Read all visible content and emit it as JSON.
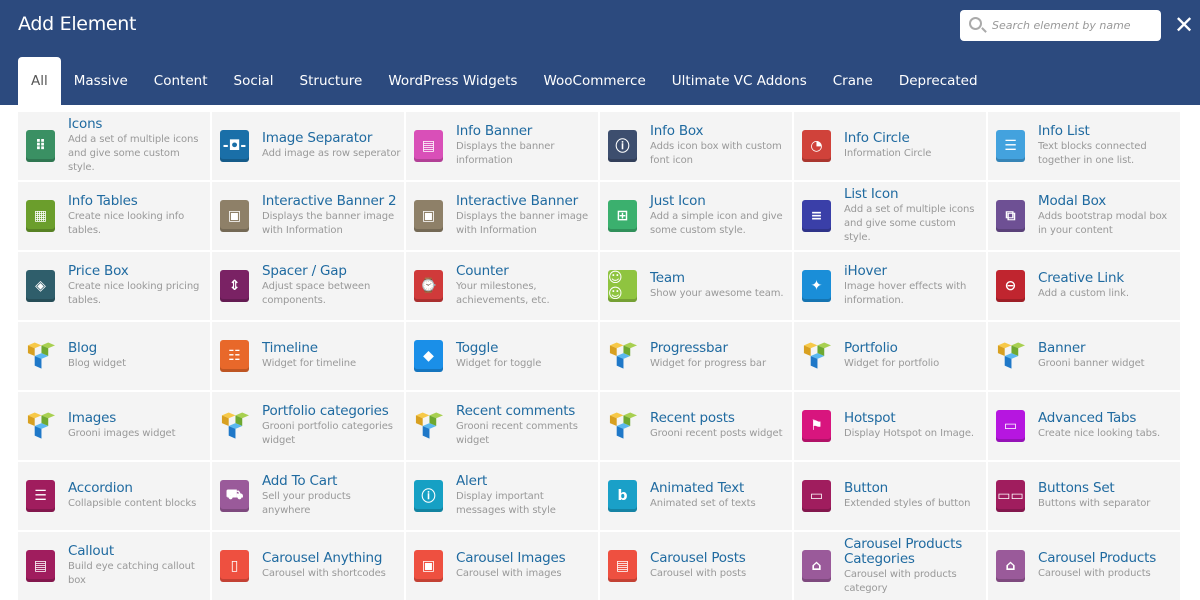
{
  "header": {
    "title": "Add Element",
    "search_placeholder": "Search element by name",
    "close_icon": "✕"
  },
  "tabs": [
    "All",
    "Massive",
    "Content",
    "Social",
    "Structure",
    "WordPress Widgets",
    "WooCommerce",
    "Ultimate VC Addons",
    "Crane",
    "Deprecated"
  ],
  "active_tab": "All",
  "elements": [
    {
      "name": "Icons",
      "desc": "Add a set of multiple icons and give some custom style.",
      "icon": "grid-icon",
      "color": "#3a9063",
      "glyph": "⠿"
    },
    {
      "name": "Image Separator",
      "desc": "Add image as row seperator",
      "icon": "separator-icon",
      "color": "#1a6fa8",
      "glyph": "-◘-"
    },
    {
      "name": "Info Banner",
      "desc": "Displays the banner information",
      "icon": "banner-icon",
      "color": "#d94fb8",
      "glyph": "▤"
    },
    {
      "name": "Info Box",
      "desc": "Adds icon box with custom font icon",
      "icon": "info-box-icon",
      "color": "#3d4e6e",
      "glyph": "ⓘ"
    },
    {
      "name": "Info Circle",
      "desc": "Information Circle",
      "icon": "info-circle-icon",
      "color": "#d0423a",
      "glyph": "◔"
    },
    {
      "name": "Info List",
      "desc": "Text blocks connected together in one list.",
      "icon": "list-icon",
      "color": "#43a2de",
      "glyph": "☰"
    },
    {
      "name": "Info Tables",
      "desc": "Create nice looking info tables.",
      "icon": "table-icon",
      "color": "#6b9e2c",
      "glyph": "▦"
    },
    {
      "name": "Interactive Banner 2",
      "desc": "Displays the banner image with Information",
      "icon": "image-icon",
      "color": "#8e8068",
      "glyph": "▣"
    },
    {
      "name": "Interactive Banner",
      "desc": "Displays the banner image with Information",
      "icon": "image-icon",
      "color": "#8e8068",
      "glyph": "▣"
    },
    {
      "name": "Just Icon",
      "desc": "Add a simple icon and give some custom style.",
      "icon": "plus-square-icon",
      "color": "#3bb06e",
      "glyph": "⊞"
    },
    {
      "name": "List Icon",
      "desc": "Add a set of multiple icons and give some custom style.",
      "icon": "ordered-list-icon",
      "color": "#3a3fa8",
      "glyph": "≡"
    },
    {
      "name": "Modal Box",
      "desc": "Adds bootstrap modal box in your content",
      "icon": "modal-icon",
      "color": "#6e5094",
      "glyph": "⧉"
    },
    {
      "name": "Price Box",
      "desc": "Create nice looking pricing tables.",
      "icon": "tag-icon",
      "color": "#2f5e6b",
      "glyph": "◈"
    },
    {
      "name": "Spacer / Gap",
      "desc": "Adjust space between components.",
      "icon": "spacer-icon",
      "color": "#7a2264",
      "glyph": "⇕"
    },
    {
      "name": "Counter",
      "desc": "Your milestones, achievements, etc.",
      "icon": "counter-icon",
      "color": "#d03a3a",
      "glyph": "⌚"
    },
    {
      "name": "Team",
      "desc": "Show your awesome team.",
      "icon": "team-icon",
      "color": "#8fc440",
      "glyph": "☺☺"
    },
    {
      "name": "iHover",
      "desc": "Image hover effects with information.",
      "icon": "cursor-sparkle-icon",
      "color": "#1a8ed8",
      "glyph": "✦"
    },
    {
      "name": "Creative Link",
      "desc": "Add a custom link.",
      "icon": "link-icon",
      "color": "#c0252f",
      "glyph": "⊖"
    },
    {
      "name": "Blog",
      "desc": "Blog widget",
      "icon": "grooni-cube-icon",
      "color": "cube"
    },
    {
      "name": "Timeline",
      "desc": "Widget for timeline",
      "icon": "timeline-icon",
      "color": "#e8682a",
      "glyph": "☷"
    },
    {
      "name": "Toggle",
      "desc": "Widget for toggle",
      "icon": "toggle-box-icon",
      "color": "#1a8fe8",
      "glyph": "◆"
    },
    {
      "name": "Progressbar",
      "desc": "Widget for progress bar",
      "icon": "grooni-cube-icon",
      "color": "cube"
    },
    {
      "name": "Portfolio",
      "desc": "Widget for portfolio",
      "icon": "grooni-cube-icon",
      "color": "cube"
    },
    {
      "name": "Banner",
      "desc": "Grooni banner widget",
      "icon": "grooni-cube-icon",
      "color": "cube"
    },
    {
      "name": "Images",
      "desc": "Grooni images widget",
      "icon": "grooni-cube-icon",
      "color": "cube"
    },
    {
      "name": "Portfolio categories",
      "desc": "Grooni portfolio categories widget",
      "icon": "grooni-cube-icon",
      "color": "cube"
    },
    {
      "name": "Recent comments",
      "desc": "Grooni recent comments widget",
      "icon": "grooni-cube-icon",
      "color": "cube"
    },
    {
      "name": "Recent posts",
      "desc": "Grooni recent posts widget",
      "icon": "grooni-cube-icon",
      "color": "cube"
    },
    {
      "name": "Hotspot",
      "desc": "Display Hotspot on Image.",
      "icon": "lighthouse-icon",
      "color": "#d8157e",
      "glyph": "⚑"
    },
    {
      "name": "Advanced Tabs",
      "desc": "Create nice looking tabs.",
      "icon": "tabs-icon",
      "color": "#b616e0",
      "glyph": "▭"
    },
    {
      "name": "Accordion",
      "desc": "Collapsible content blocks",
      "icon": "accordion-icon",
      "color": "#a01d5e",
      "glyph": "☰"
    },
    {
      "name": "Add To Cart",
      "desc": "Sell your products anywhere",
      "icon": "cart-icon",
      "color": "#9a5a9a",
      "glyph": "⛟"
    },
    {
      "name": "Alert",
      "desc": "Display important messages with style",
      "icon": "alert-icon",
      "color": "#16a0c4",
      "glyph": "ⓘ"
    },
    {
      "name": "Animated Text",
      "desc": "Animated set of texts",
      "icon": "animated-text-icon",
      "color": "#1aa0c8",
      "glyph": "b"
    },
    {
      "name": "Button",
      "desc": "Extended styles of button",
      "icon": "button-icon",
      "color": "#a01d5e",
      "glyph": "▭"
    },
    {
      "name": "Buttons Set",
      "desc": "Buttons with separator",
      "icon": "buttons-set-icon",
      "color": "#a01d5e",
      "glyph": "▭▭"
    },
    {
      "name": "Callout",
      "desc": "Build eye catching callout box",
      "icon": "callout-icon",
      "color": "#a01d5e",
      "glyph": "▤"
    },
    {
      "name": "Carousel Anything",
      "desc": "Carousel with shortcodes",
      "icon": "carousel-icon",
      "color": "#ee5040",
      "glyph": "▯"
    },
    {
      "name": "Carousel Images",
      "desc": "Carousel with images",
      "icon": "carousel-images-icon",
      "color": "#ee5040",
      "glyph": "▣"
    },
    {
      "name": "Carousel Posts",
      "desc": "Carousel with posts",
      "icon": "carousel-posts-icon",
      "color": "#ee5040",
      "glyph": "▤"
    },
    {
      "name": "Carousel Products Categories",
      "desc": "Carousel with products category",
      "icon": "shopping-bag-icon",
      "color": "#9a5a9a",
      "glyph": "⌂"
    },
    {
      "name": "Carousel Products",
      "desc": "Carousel with products",
      "icon": "shopping-bag-icon",
      "color": "#9a5a9a",
      "glyph": "⌂"
    }
  ]
}
